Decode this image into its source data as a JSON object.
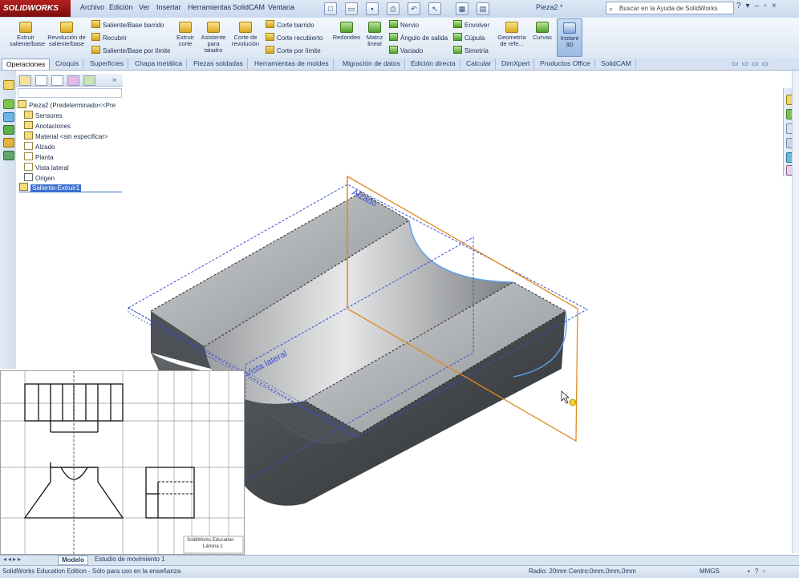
{
  "app": {
    "brand": "SOLIDWORKS",
    "document_title": "Pieza2 *",
    "help_search": "Buscar en la Ayuda de SolidWorks"
  },
  "menu": [
    "Archivo",
    "Edición",
    "Ver",
    "Insertar",
    "Herramientas",
    "SolidCAM",
    "Ventana"
  ],
  "ribbon": {
    "big_buttons": [
      {
        "label": "Extruir saliente/base"
      },
      {
        "label": "Revolución de saliente/base"
      },
      {
        "label": "Extruir corte"
      },
      {
        "label": "Asistente para taladro"
      },
      {
        "label": "Corte de revolución"
      },
      {
        "label": "Redondeo"
      },
      {
        "label": "Matriz lineal"
      },
      {
        "label": "Geometría de refe..."
      },
      {
        "label": "Curvas"
      },
      {
        "label": "Instant 3D"
      }
    ],
    "small_col1": [
      "Saliente/Base barrido",
      "Recubrir",
      "Saliente/Base por límite"
    ],
    "small_col2": [
      "Corte barrido",
      "Corte recubierto",
      "Corte por límite"
    ],
    "small_col3": [
      "Nervio",
      "Ángulo de salida",
      "Vaciado"
    ],
    "small_col4": [
      "Envolver",
      "Cúpula",
      "Simetría"
    ]
  },
  "tabs": [
    "Operaciones",
    "Croquis",
    "Superficies",
    "Chapa metálica",
    "Piezas soldadas",
    "Herramientas de moldes",
    "Migración de datos",
    "Edición directa",
    "Calcular",
    "DimXpert",
    "Productos Office",
    "SolidCAM"
  ],
  "active_tab": "Operaciones",
  "tree": {
    "root": "Pieza2 (Predeterminado<<Pre",
    "items": [
      "Sensores",
      "Anotaciones",
      "Material <sin especificar>",
      "Alzado",
      "Planta",
      "Vista lateral",
      "Origen",
      "Saliente-Extruir1"
    ],
    "selected": "Saliente-Extruir1"
  },
  "viewport": {
    "plane_labels": [
      "Alzado",
      "Vista lateral"
    ]
  },
  "inset": {
    "caption_line1": "SolidWorks Education",
    "caption_line2": "Lámina 1"
  },
  "bottom_tabs": [
    "Modelo",
    "Estudio de movimiento 1"
  ],
  "status": {
    "left": "SolidWorks Education Edition - Sólo para uso en la enseñanza",
    "measure": "Radio: 20mm  Centro:0mm,0mm,0mm",
    "units": "MMGS"
  },
  "colors": {
    "brand": "#a11a1a",
    "plane_blue": "#3b4fd0",
    "plane_orange": "#e08a1e",
    "selection": "#3b6fd1"
  }
}
